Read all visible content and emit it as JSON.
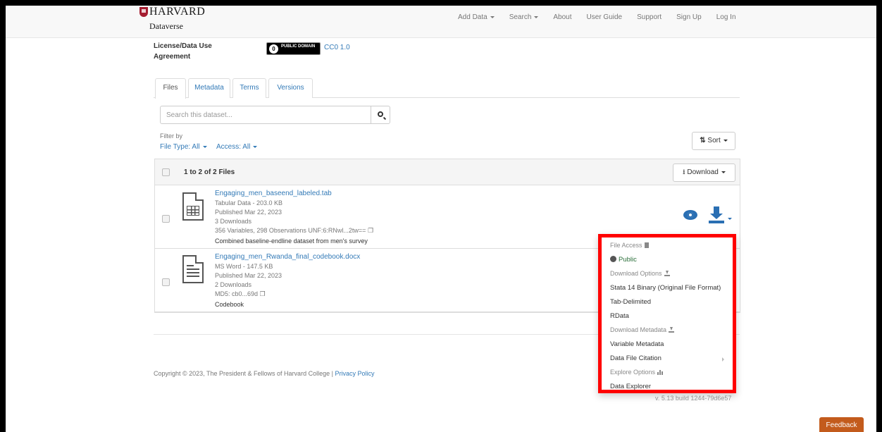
{
  "brand": {
    "name": "HARVARD",
    "sub": "Dataverse"
  },
  "nav": {
    "add_data": "Add Data",
    "search": "Search",
    "about": "About",
    "user_guide": "User Guide",
    "support": "Support",
    "sign_up": "Sign Up",
    "log_in": "Log In"
  },
  "license": {
    "label": "License/Data Use Agreement",
    "badge_text": "PUBLIC DOMAIN",
    "badge_icon": "cc-zero-icon",
    "link": "CC0 1.0"
  },
  "tabs": [
    {
      "label": "Files"
    },
    {
      "label": "Metadata"
    },
    {
      "label": "Terms"
    },
    {
      "label": "Versions"
    }
  ],
  "search": {
    "placeholder": "Search this dataset..."
  },
  "filter": {
    "label": "Filter by",
    "file_type": "File Type: All",
    "access": "Access: All"
  },
  "sort": {
    "label": "Sort"
  },
  "table": {
    "count": "1 to 2 of 2 Files",
    "download_label": "Download"
  },
  "files": [
    {
      "name": "Engaging_men_baseend_labeled.tab",
      "type": "Tabular Data - 203.0 KB",
      "published": "Published Mar 22, 2023",
      "downloads": "3 Downloads",
      "detail": "356 Variables, 298 Observations UNF:6:RNwl...2tw==",
      "description": "Combined baseline-endline dataset from men's survey"
    },
    {
      "name": "Engaging_men_Rwanda_final_codebook.docx",
      "type": "MS Word - 147.5 KB",
      "published": "Published Mar 22, 2023",
      "downloads": "2 Downloads",
      "detail": "MD5: cb0...69d",
      "description": "Codebook"
    }
  ],
  "dropdown": {
    "file_access": "File Access",
    "public": "Public",
    "download_options": "Download Options",
    "stata": "Stata 14 Binary (Original File Format)",
    "tab_delimited": "Tab-Delimited",
    "rdata": "RData",
    "download_metadata": "Download Metadata",
    "variable_metadata": "Variable Metadata",
    "data_file_citation": "Data File Citation",
    "explore_options": "Explore Options",
    "data_explorer": "Data Explorer"
  },
  "footer": {
    "copyright": "Copyright © 2023, The President & Fellows of Harvard College |",
    "privacy": "Privacy Policy",
    "version": "v. 5.13 build 1244-79d6e57"
  },
  "feedback": "Feedback",
  "colors": {
    "link": "#337ab7",
    "highlight": "#ff0000",
    "feedback": "#c35b1c",
    "brand": "#a51c30"
  }
}
